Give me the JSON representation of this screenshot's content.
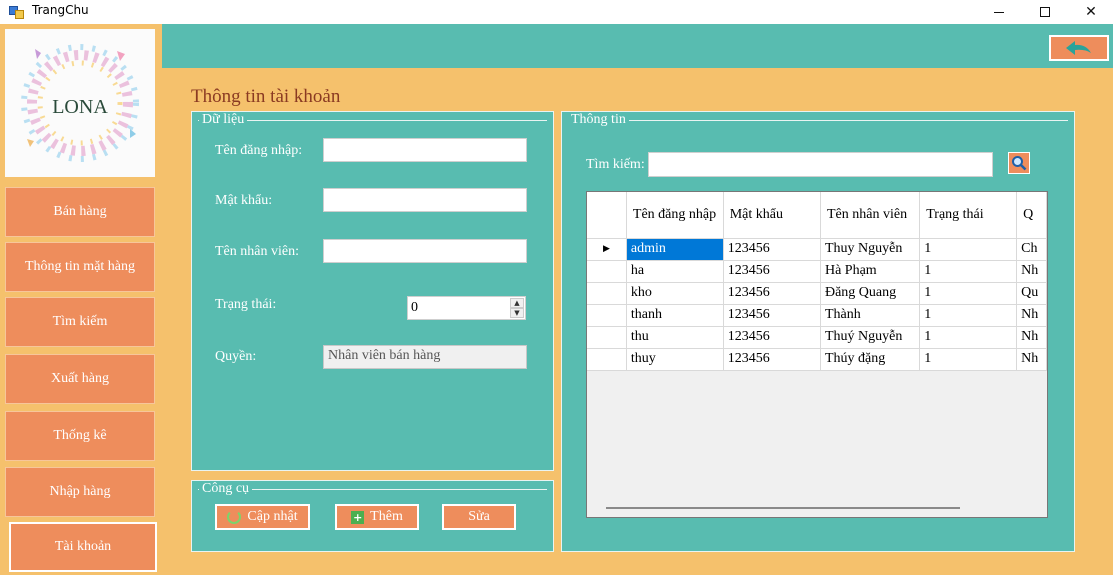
{
  "window": {
    "title": "TrangChu"
  },
  "sidebar": {
    "items": [
      {
        "label": "Bán hàng"
      },
      {
        "label": "Thông tin mặt hàng"
      },
      {
        "label": "Tìm kiếm"
      },
      {
        "label": "Xuất hàng"
      },
      {
        "label": "Thống kê"
      },
      {
        "label": "Nhập hàng"
      },
      {
        "label": "Tài khoản"
      }
    ],
    "active": "Tài khoản",
    "logo_text": "LONA"
  },
  "page": {
    "title": "Thông tin tài khoản"
  },
  "data_panel": {
    "legend": "Dữ liệu",
    "username_label": "Tên đăng nhập:",
    "username_value": "",
    "password_label": "Mật khẩu:",
    "password_value": "",
    "employee_label": "Tên nhân viên:",
    "employee_value": "",
    "status_label": "Trạng thái:",
    "status_value": "0",
    "role_label": "Quyền:",
    "role_value": "Nhân viên bán hàng"
  },
  "tools_panel": {
    "legend": "Công cụ",
    "update_label": "Cập nhật",
    "add_label": "Thêm",
    "edit_label": "Sửa"
  },
  "info_panel": {
    "legend": "Thông tin",
    "search_label": "Tìm kiếm:",
    "search_value": "",
    "columns": [
      "Tên đăng nhập",
      "Mật khẩu",
      "Tên nhân viên",
      "Trạng thái",
      "Q"
    ],
    "rows": [
      [
        "admin",
        "123456",
        "Thuy Nguyễn",
        "1",
        "Ch"
      ],
      [
        "ha",
        "123456",
        "Hà Phạm",
        "1",
        "Nh"
      ],
      [
        "kho",
        "123456",
        "Đăng Quang",
        "1",
        "Qu"
      ],
      [
        "thanh",
        "123456",
        "Thành",
        "1",
        "Nh"
      ],
      [
        "thu",
        "123456",
        "Thuý Nguyễn",
        "1",
        "Nh"
      ],
      [
        "thuy",
        "123456",
        "Thúy đặng",
        "1",
        "Nh"
      ]
    ],
    "selected_row": 0
  },
  "colors": {
    "teal": "#58bcb0",
    "orange_button": "#ee8d5c",
    "sand_background": "#f5c16c",
    "title_brown": "#8a3a22",
    "selection_blue": "#0078d7"
  },
  "icons": {
    "back": "back-arrow-icon",
    "search": "magnifier-icon",
    "update": "refresh-icon",
    "add": "plus-icon"
  }
}
